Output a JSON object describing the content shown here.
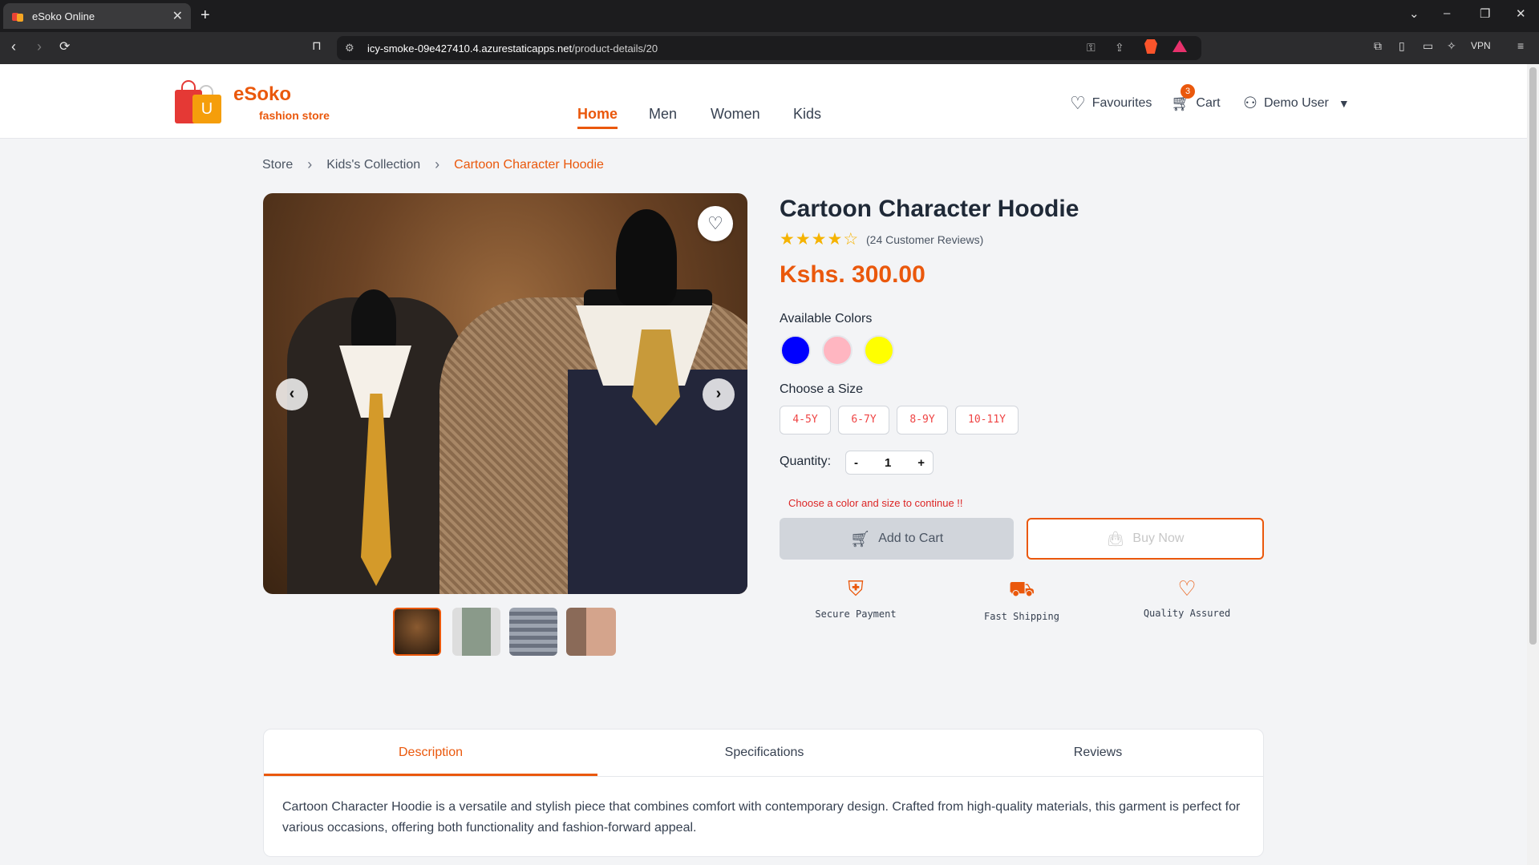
{
  "browser": {
    "tab_title": "eSoko Online",
    "url_host": "icy-smoke-09e427410.4.azurestaticapps.net",
    "url_path": "/product-details/20",
    "vpn_label": "VPN"
  },
  "header": {
    "brand": "eSoko",
    "tagline": "fashion store",
    "logo_letter": "U",
    "nav": [
      "Home",
      "Men",
      "Women",
      "Kids"
    ],
    "active_nav": "Home",
    "favourites": "Favourites",
    "cart": "Cart",
    "cart_count": "3",
    "user": "Demo User"
  },
  "breadcrumb": [
    "Store",
    "Kids's Collection",
    "Cartoon Character Hoodie"
  ],
  "product": {
    "title": "Cartoon Character Hoodie",
    "rating": 4,
    "rating_max": 5,
    "reviews": "(24 Customer Reviews)",
    "price": "Kshs. 300.00",
    "colors_label": "Available Colors",
    "colors": [
      "#0000ff",
      "#ffb6c1",
      "#ffff00"
    ],
    "size_label": "Choose a Size",
    "sizes": [
      "4-5Y",
      "6-7Y",
      "8-9Y",
      "10-11Y"
    ],
    "quantity_label": "Quantity:",
    "quantity": "1",
    "qty_minus": "-",
    "qty_plus": "+",
    "warning": "Choose a color and size to continue !!",
    "add_to_cart": "Add to Cart",
    "buy_now": "Buy Now",
    "features": [
      "Secure Payment",
      "Fast Shipping",
      "Quality Assured"
    ]
  },
  "tabs": {
    "items": [
      "Description",
      "Specifications",
      "Reviews"
    ],
    "active": "Description",
    "description": "Cartoon Character Hoodie is a versatile and stylish piece that combines comfort with contemporary design. Crafted from high-quality materials, this garment is perfect for various occasions, offering both functionality and fashion-forward appeal."
  },
  "colors": {
    "accent": "#ea580c",
    "warning": "#dc2626"
  }
}
